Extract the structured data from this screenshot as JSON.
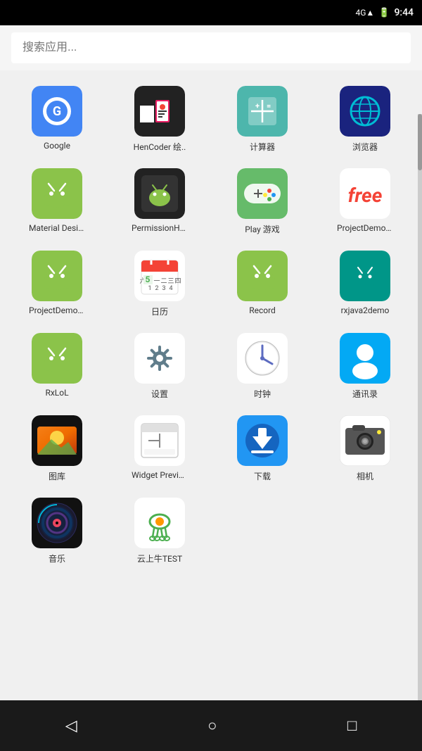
{
  "statusBar": {
    "signal": "4G",
    "battery": "🔋",
    "time": "9:44"
  },
  "search": {
    "placeholder": "搜索应用..."
  },
  "apps": [
    {
      "id": "google",
      "label": "Google",
      "iconClass": "icon-google",
      "iconContent": "google"
    },
    {
      "id": "hencoder",
      "label": "HenCoder 绘..",
      "iconClass": "icon-hencoder",
      "iconContent": "hencoder"
    },
    {
      "id": "calculator",
      "label": "计算器",
      "iconClass": "icon-calc",
      "iconContent": "calc"
    },
    {
      "id": "browser",
      "label": "浏览器",
      "iconClass": "icon-browser",
      "iconContent": "browser"
    },
    {
      "id": "material",
      "label": "Material Desig..",
      "iconClass": "icon-material",
      "iconContent": "android"
    },
    {
      "id": "permission",
      "label": "PermissionHel..",
      "iconClass": "icon-permission",
      "iconContent": "permission"
    },
    {
      "id": "playgames",
      "label": "Play 游戏",
      "iconClass": "icon-play",
      "iconContent": "gamepad"
    },
    {
      "id": "projectfree",
      "label": "ProjectDemoD..",
      "iconClass": "icon-projectfree",
      "iconContent": "free"
    },
    {
      "id": "projectd1",
      "label": "ProjectDemoD..",
      "iconClass": "icon-projectd1",
      "iconContent": "android"
    },
    {
      "id": "calendar",
      "label": "日历",
      "iconClass": "icon-calendar",
      "iconContent": "calendar"
    },
    {
      "id": "record",
      "label": "Record",
      "iconClass": "icon-record",
      "iconContent": "android"
    },
    {
      "id": "rxjava",
      "label": "rxjava2demo",
      "iconClass": "icon-rxjava",
      "iconContent": "rxjava"
    },
    {
      "id": "rxlol",
      "label": "RxLoL",
      "iconClass": "icon-rxlol",
      "iconContent": "android"
    },
    {
      "id": "settings",
      "label": "设置",
      "iconClass": "icon-settings",
      "iconContent": "settings"
    },
    {
      "id": "clock",
      "label": "时钟",
      "iconClass": "icon-clock",
      "iconContent": "clock"
    },
    {
      "id": "contacts",
      "label": "通讯录",
      "iconClass": "icon-contacts",
      "iconContent": "contacts"
    },
    {
      "id": "gallery",
      "label": "图库",
      "iconClass": "icon-gallery",
      "iconContent": "gallery"
    },
    {
      "id": "widget",
      "label": "Widget Preview",
      "iconClass": "icon-widget",
      "iconContent": "widget"
    },
    {
      "id": "download",
      "label": "下载",
      "iconClass": "icon-download",
      "iconContent": "download"
    },
    {
      "id": "camera",
      "label": "相机",
      "iconClass": "icon-camera",
      "iconContent": "camera"
    },
    {
      "id": "music",
      "label": "音乐",
      "iconClass": "icon-music",
      "iconContent": "music"
    },
    {
      "id": "yunshanniu",
      "label": "云上牛TEST",
      "iconClass": "icon-yunshanniu",
      "iconContent": "yunshanniu"
    }
  ],
  "navBar": {
    "back": "◁",
    "home": "○",
    "recents": "□"
  }
}
